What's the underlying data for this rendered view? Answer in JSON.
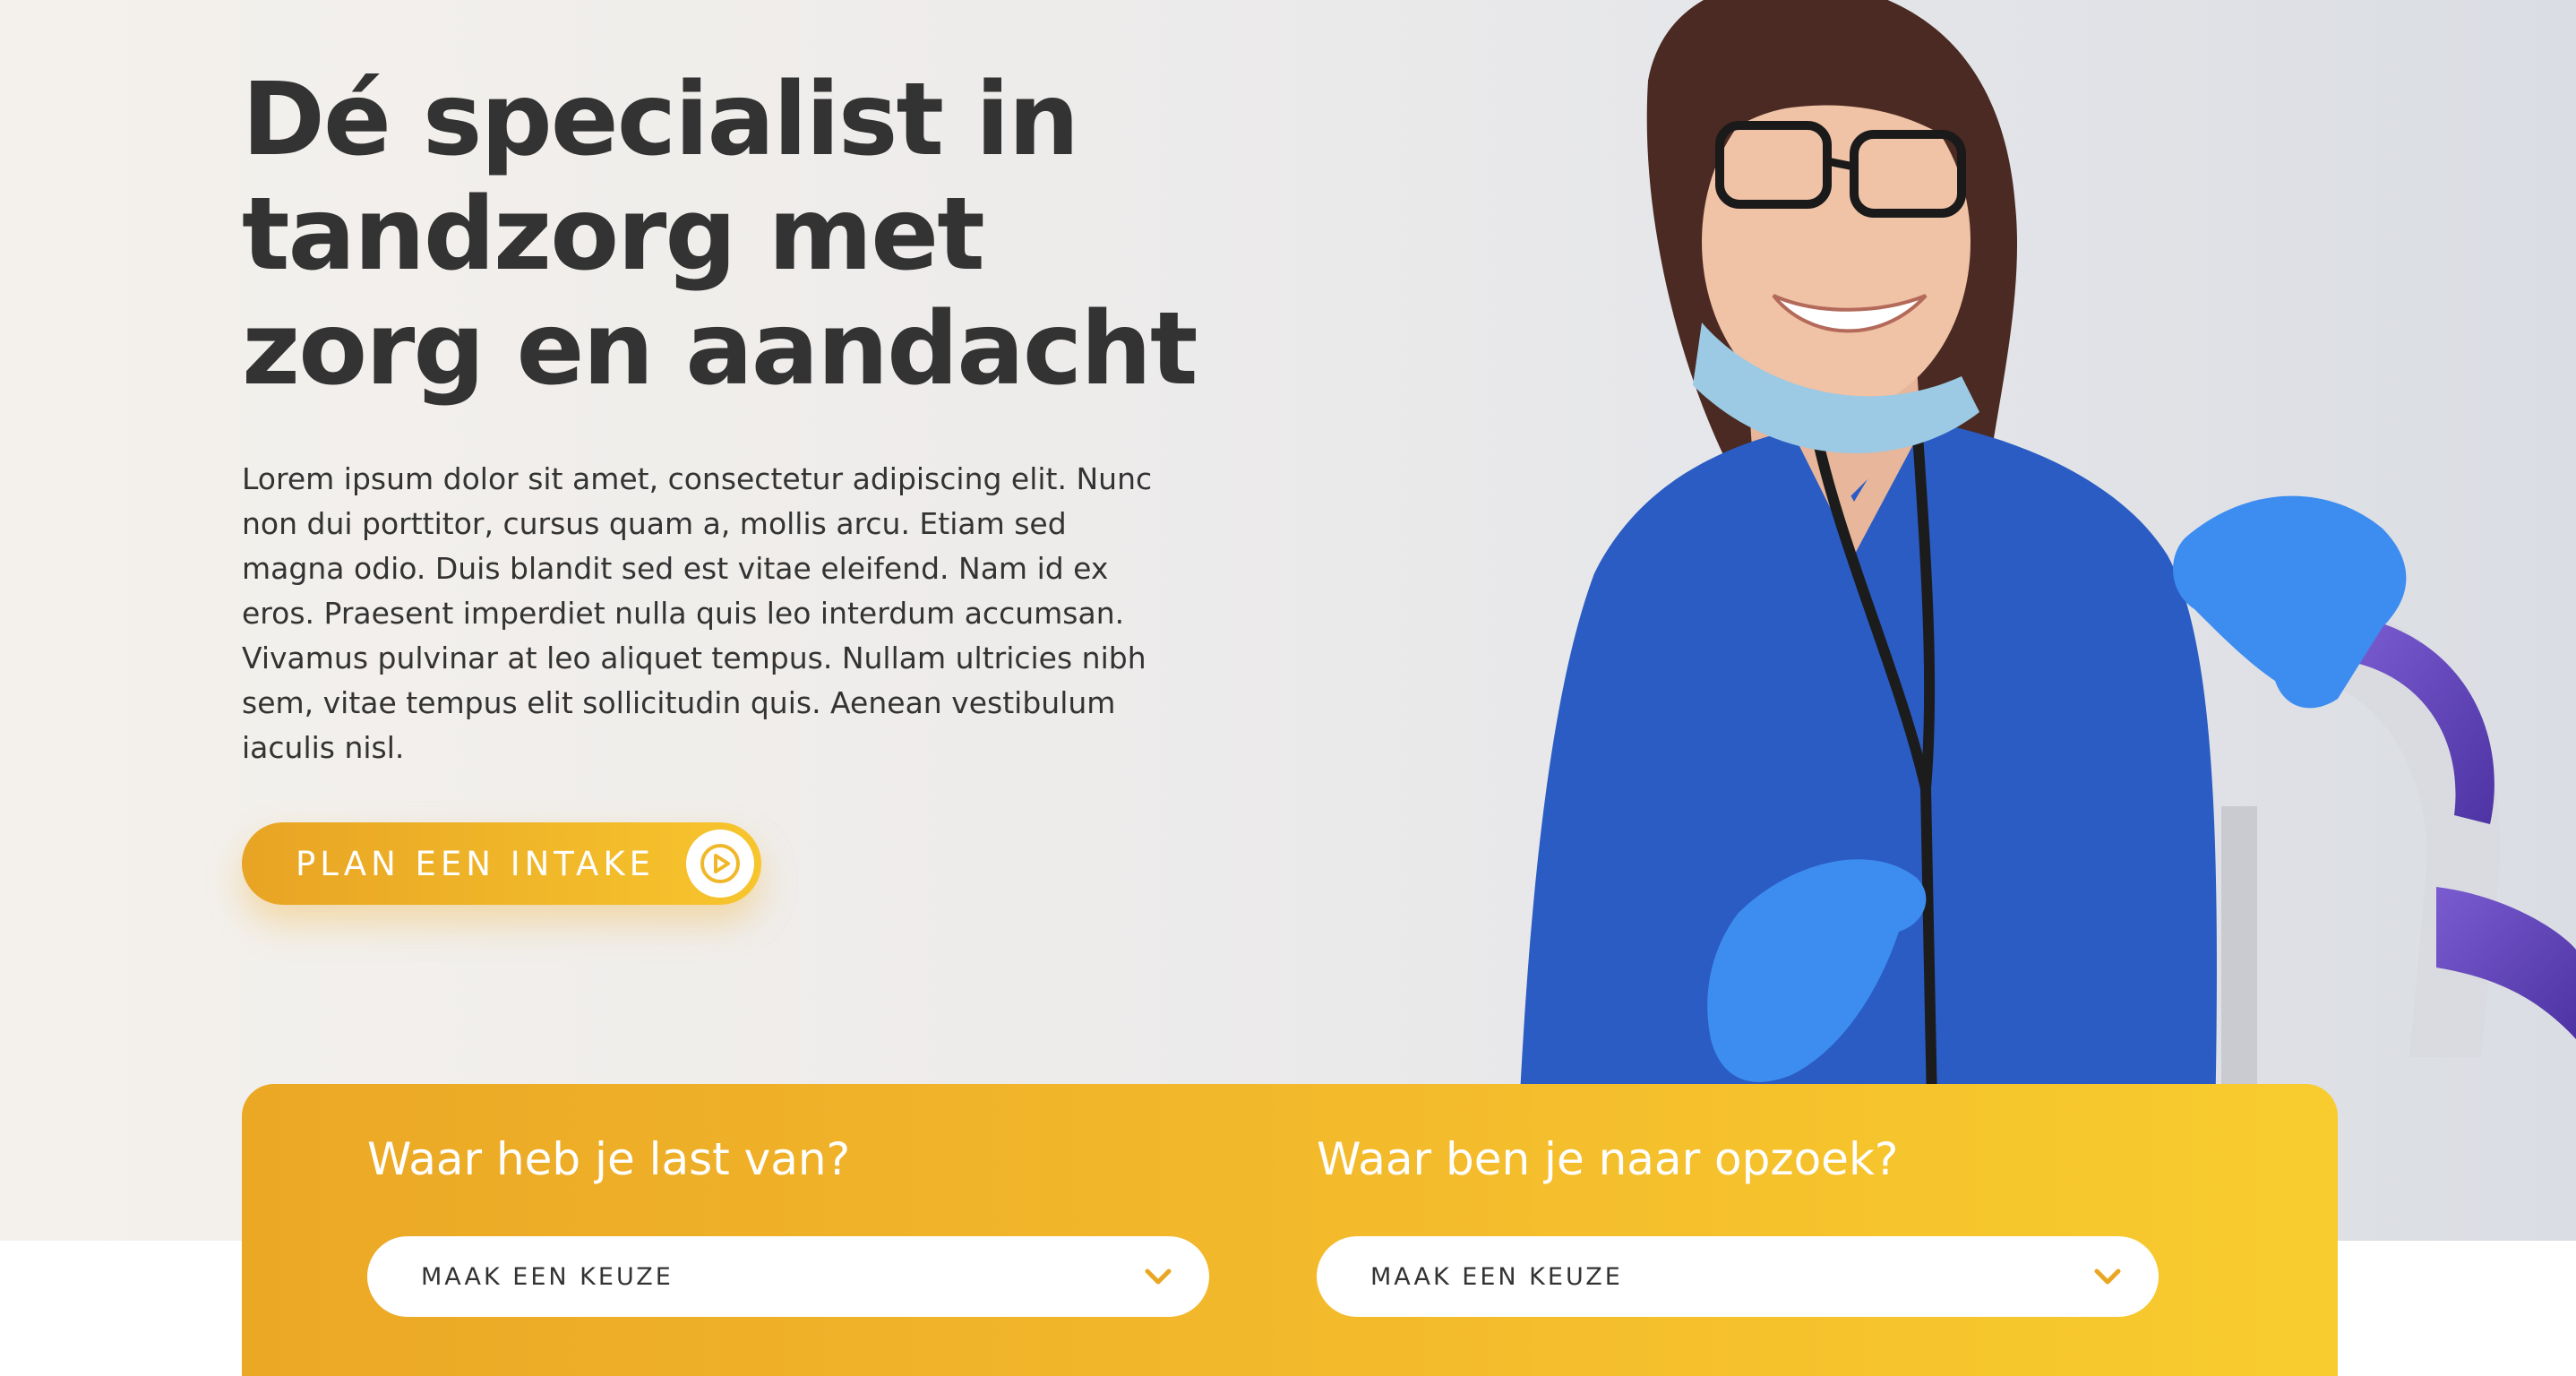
{
  "hero": {
    "title_lines": [
      "Dé specialist in",
      "tandzorg met",
      "zorg en aandacht"
    ],
    "text": "Lorem ipsum dolor sit amet, consectetur adipiscing elit. Nunc non dui porttitor, cursus quam a, mollis arcu. Etiam sed magna odio. Duis blandit sed est vitae eleifend. Nam id ex eros. Praesent imperdiet nulla quis leo interdum accumsan. Vivamus pulvinar at leo aliquet tempus. Nullam ultricies nibh sem, vitae tempus elit sollicitudin quis. Aenean vestibulum iaculis nisl.",
    "cta_label": "PLAN EEN INTAKE",
    "cta_icon": "play-circle-icon"
  },
  "search": {
    "left": {
      "heading": "Waar heb je last van?",
      "select_value": "MAAK EEN KEUZE"
    },
    "right": {
      "heading": "Waar ben je naar opzoek?",
      "select_value": "MAAK EEN KEUZE"
    }
  },
  "colors": {
    "accent_start": "#e8a424",
    "accent_end": "#f8cc2e",
    "text_dark": "#333333",
    "scrubs_blue": "#2a5cc4",
    "glove_blue": "#3d8df0"
  }
}
